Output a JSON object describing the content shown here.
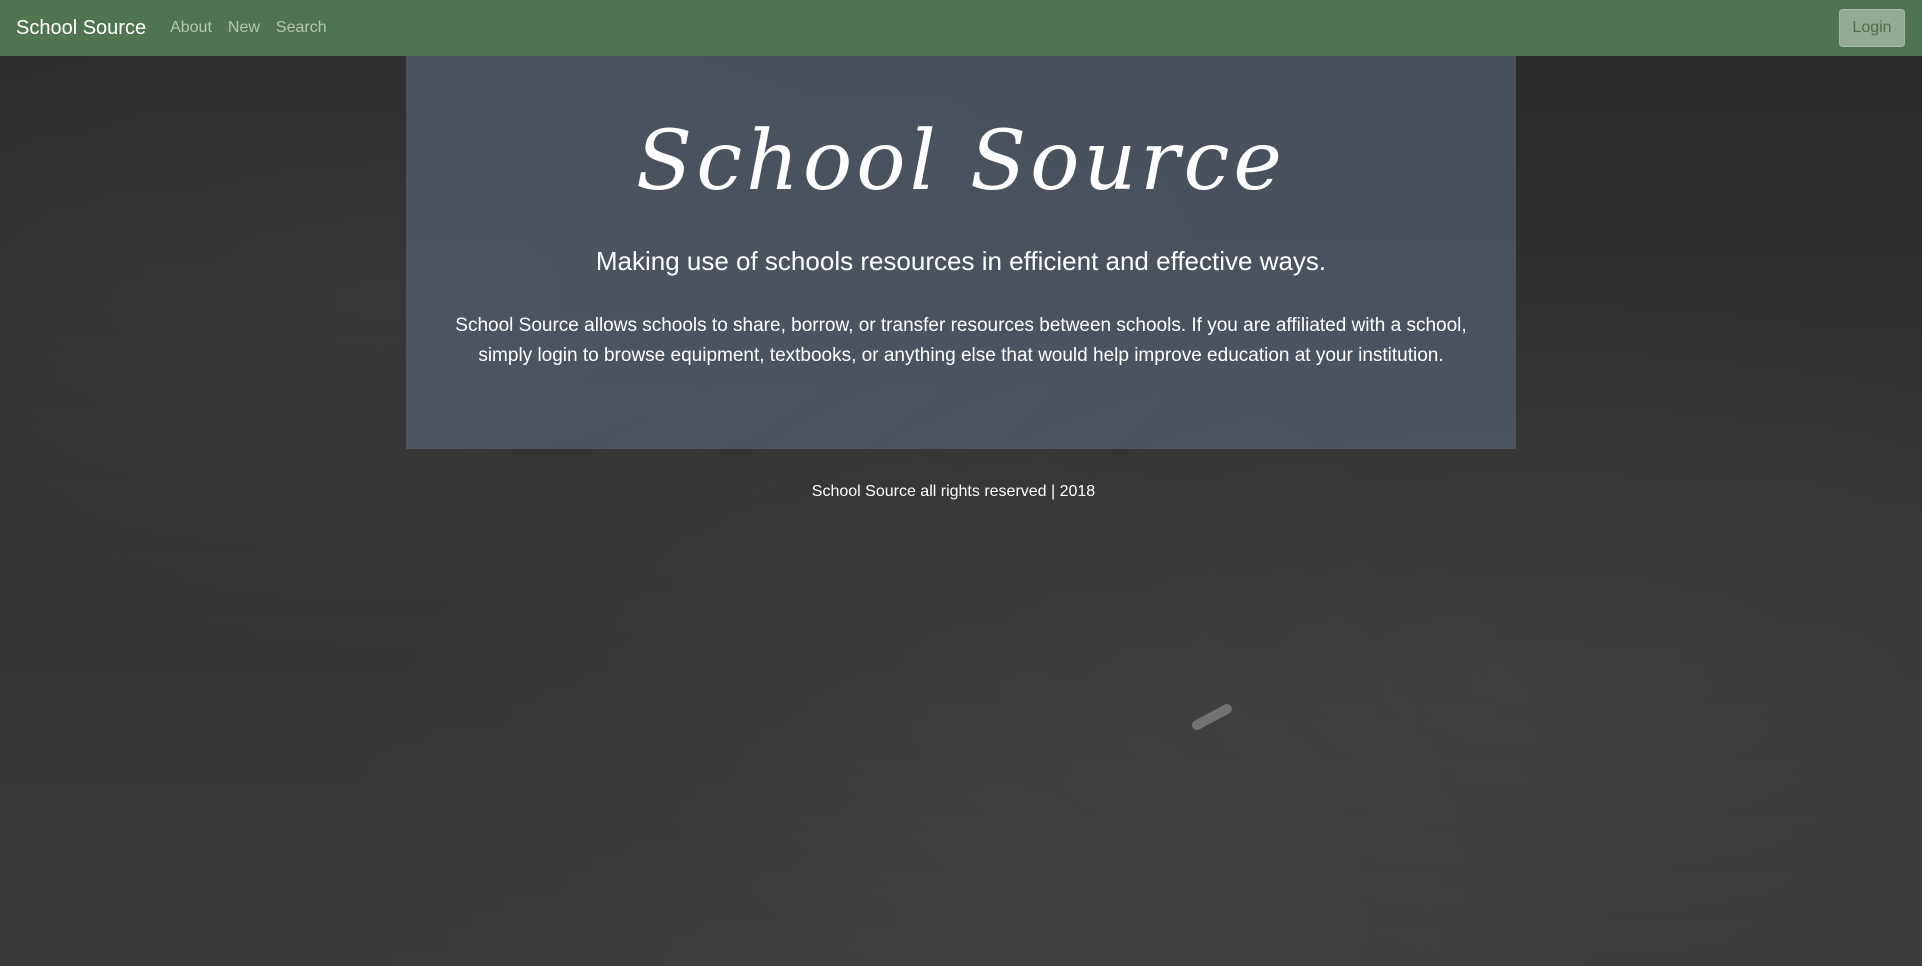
{
  "navbar": {
    "brand": "School Source",
    "links": [
      "About",
      "New",
      "Search"
    ],
    "login_label": "Login"
  },
  "hero": {
    "title": "School Source",
    "lead": "Making use of schools resources in efficient and effective ways.",
    "body": "School Source allows schools to share, borrow, or transfer resources between schools. If you are affiliated with a school, simply login to browse equipment, textbooks, or anything else that would help improve education at your institution."
  },
  "footer": {
    "text": "School Source all rights reserved | 2018"
  },
  "colors": {
    "navbar": "#4e7550",
    "jumbotron": "#555f70",
    "background": "#2f2f2f"
  }
}
